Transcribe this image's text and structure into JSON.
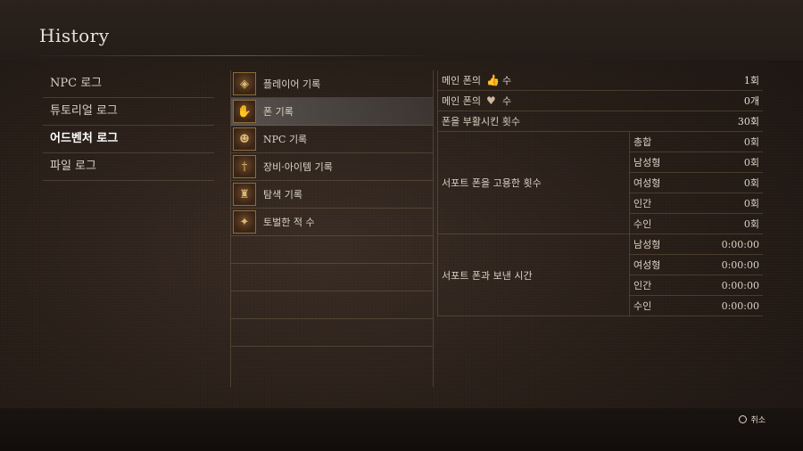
{
  "title": "History",
  "categories": [
    {
      "label": "NPC 로그",
      "active": false
    },
    {
      "label": "튜토리얼 로그",
      "active": false
    },
    {
      "label": "어드벤처 로그",
      "active": true
    },
    {
      "label": "파일 로그",
      "active": false
    }
  ],
  "records": [
    {
      "label": "플레이어 기록",
      "icon": "player-emblem-icon",
      "active": false
    },
    {
      "label": "폰 기록",
      "icon": "pawn-hand-icon",
      "active": true
    },
    {
      "label": "NPC 기록",
      "icon": "npc-portrait-icon",
      "active": false
    },
    {
      "label": "장비·아이템 기록",
      "icon": "equipment-icon",
      "active": false
    },
    {
      "label": "탐색 기록",
      "icon": "exploration-icon",
      "active": false
    },
    {
      "label": "토벌한 적 수",
      "icon": "enemy-icon",
      "active": false
    }
  ],
  "stats": {
    "main_likes_label_a": "메인 폰의",
    "main_likes_label_b": "수",
    "main_likes_value": "1회",
    "main_hearts_label_a": "메인 폰의",
    "main_hearts_label_b": "수",
    "main_hearts_value": "0개",
    "revived_label": "폰을 부활시킨 횟수",
    "revived_value": "30회",
    "hired_label": "서포트 폰을 고용한 횟수",
    "hired_rows": [
      {
        "label": "총합",
        "value": "0회"
      },
      {
        "label": "남성형",
        "value": "0회"
      },
      {
        "label": "여성형",
        "value": "0회"
      },
      {
        "label": "인간",
        "value": "0회"
      },
      {
        "label": "수인",
        "value": "0회"
      }
    ],
    "time_label": "서포트 폰과 보낸 시간",
    "time_rows": [
      {
        "label": "남성형",
        "value": "0:00:00"
      },
      {
        "label": "여성형",
        "value": "0:00:00"
      },
      {
        "label": "인간",
        "value": "0:00:00"
      },
      {
        "label": "수인",
        "value": "0:00:00"
      }
    ]
  },
  "footer": {
    "cancel_label": "취소"
  }
}
